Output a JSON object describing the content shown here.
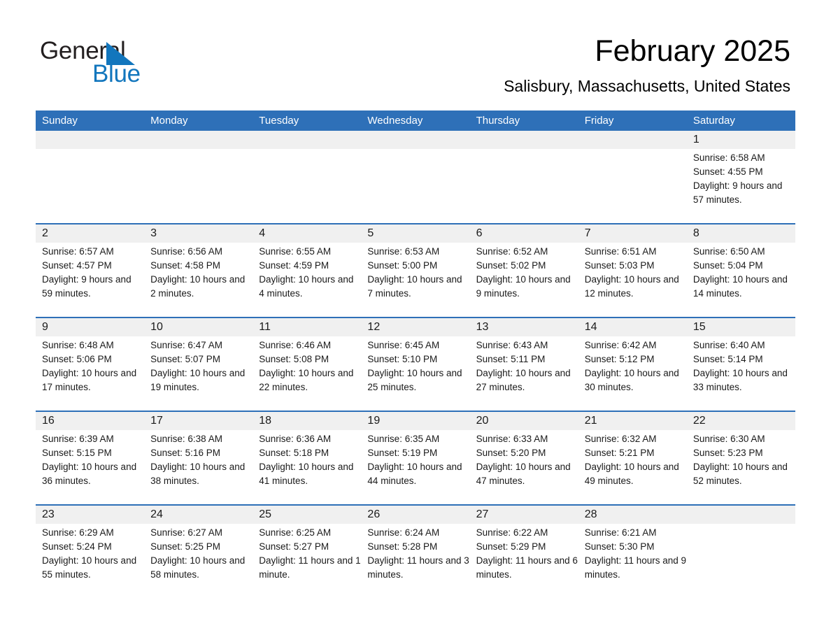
{
  "logo": {
    "word_one": "General",
    "word_two": "Blue",
    "triangle_color": "#1276bd",
    "text_color": "#231f20"
  },
  "header": {
    "title": "February 2025",
    "subtitle": "Salisbury, Massachusetts, United States"
  },
  "theme": {
    "header_blue": "#2e70b8",
    "row_divider_blue": "#2e70b8",
    "date_band_gray": "#f0f0f0",
    "cell_background": "#ffffff"
  },
  "calendar": {
    "weekdays": [
      "Sunday",
      "Monday",
      "Tuesday",
      "Wednesday",
      "Thursday",
      "Friday",
      "Saturday"
    ],
    "weeks": [
      [
        {
          "day": "",
          "sunrise": "",
          "sunset": "",
          "daylight": ""
        },
        {
          "day": "",
          "sunrise": "",
          "sunset": "",
          "daylight": ""
        },
        {
          "day": "",
          "sunrise": "",
          "sunset": "",
          "daylight": ""
        },
        {
          "day": "",
          "sunrise": "",
          "sunset": "",
          "daylight": ""
        },
        {
          "day": "",
          "sunrise": "",
          "sunset": "",
          "daylight": ""
        },
        {
          "day": "",
          "sunrise": "",
          "sunset": "",
          "daylight": ""
        },
        {
          "day": "1",
          "sunrise": "Sunrise: 6:58 AM",
          "sunset": "Sunset: 4:55 PM",
          "daylight": "Daylight: 9 hours and 57 minutes."
        }
      ],
      [
        {
          "day": "2",
          "sunrise": "Sunrise: 6:57 AM",
          "sunset": "Sunset: 4:57 PM",
          "daylight": "Daylight: 9 hours and 59 minutes."
        },
        {
          "day": "3",
          "sunrise": "Sunrise: 6:56 AM",
          "sunset": "Sunset: 4:58 PM",
          "daylight": "Daylight: 10 hours and 2 minutes."
        },
        {
          "day": "4",
          "sunrise": "Sunrise: 6:55 AM",
          "sunset": "Sunset: 4:59 PM",
          "daylight": "Daylight: 10 hours and 4 minutes."
        },
        {
          "day": "5",
          "sunrise": "Sunrise: 6:53 AM",
          "sunset": "Sunset: 5:00 PM",
          "daylight": "Daylight: 10 hours and 7 minutes."
        },
        {
          "day": "6",
          "sunrise": "Sunrise: 6:52 AM",
          "sunset": "Sunset: 5:02 PM",
          "daylight": "Daylight: 10 hours and 9 minutes."
        },
        {
          "day": "7",
          "sunrise": "Sunrise: 6:51 AM",
          "sunset": "Sunset: 5:03 PM",
          "daylight": "Daylight: 10 hours and 12 minutes."
        },
        {
          "day": "8",
          "sunrise": "Sunrise: 6:50 AM",
          "sunset": "Sunset: 5:04 PM",
          "daylight": "Daylight: 10 hours and 14 minutes."
        }
      ],
      [
        {
          "day": "9",
          "sunrise": "Sunrise: 6:48 AM",
          "sunset": "Sunset: 5:06 PM",
          "daylight": "Daylight: 10 hours and 17 minutes."
        },
        {
          "day": "10",
          "sunrise": "Sunrise: 6:47 AM",
          "sunset": "Sunset: 5:07 PM",
          "daylight": "Daylight: 10 hours and 19 minutes."
        },
        {
          "day": "11",
          "sunrise": "Sunrise: 6:46 AM",
          "sunset": "Sunset: 5:08 PM",
          "daylight": "Daylight: 10 hours and 22 minutes."
        },
        {
          "day": "12",
          "sunrise": "Sunrise: 6:45 AM",
          "sunset": "Sunset: 5:10 PM",
          "daylight": "Daylight: 10 hours and 25 minutes."
        },
        {
          "day": "13",
          "sunrise": "Sunrise: 6:43 AM",
          "sunset": "Sunset: 5:11 PM",
          "daylight": "Daylight: 10 hours and 27 minutes."
        },
        {
          "day": "14",
          "sunrise": "Sunrise: 6:42 AM",
          "sunset": "Sunset: 5:12 PM",
          "daylight": "Daylight: 10 hours and 30 minutes."
        },
        {
          "day": "15",
          "sunrise": "Sunrise: 6:40 AM",
          "sunset": "Sunset: 5:14 PM",
          "daylight": "Daylight: 10 hours and 33 minutes."
        }
      ],
      [
        {
          "day": "16",
          "sunrise": "Sunrise: 6:39 AM",
          "sunset": "Sunset: 5:15 PM",
          "daylight": "Daylight: 10 hours and 36 minutes."
        },
        {
          "day": "17",
          "sunrise": "Sunrise: 6:38 AM",
          "sunset": "Sunset: 5:16 PM",
          "daylight": "Daylight: 10 hours and 38 minutes."
        },
        {
          "day": "18",
          "sunrise": "Sunrise: 6:36 AM",
          "sunset": "Sunset: 5:18 PM",
          "daylight": "Daylight: 10 hours and 41 minutes."
        },
        {
          "day": "19",
          "sunrise": "Sunrise: 6:35 AM",
          "sunset": "Sunset: 5:19 PM",
          "daylight": "Daylight: 10 hours and 44 minutes."
        },
        {
          "day": "20",
          "sunrise": "Sunrise: 6:33 AM",
          "sunset": "Sunset: 5:20 PM",
          "daylight": "Daylight: 10 hours and 47 minutes."
        },
        {
          "day": "21",
          "sunrise": "Sunrise: 6:32 AM",
          "sunset": "Sunset: 5:21 PM",
          "daylight": "Daylight: 10 hours and 49 minutes."
        },
        {
          "day": "22",
          "sunrise": "Sunrise: 6:30 AM",
          "sunset": "Sunset: 5:23 PM",
          "daylight": "Daylight: 10 hours and 52 minutes."
        }
      ],
      [
        {
          "day": "23",
          "sunrise": "Sunrise: 6:29 AM",
          "sunset": "Sunset: 5:24 PM",
          "daylight": "Daylight: 10 hours and 55 minutes."
        },
        {
          "day": "24",
          "sunrise": "Sunrise: 6:27 AM",
          "sunset": "Sunset: 5:25 PM",
          "daylight": "Daylight: 10 hours and 58 minutes."
        },
        {
          "day": "25",
          "sunrise": "Sunrise: 6:25 AM",
          "sunset": "Sunset: 5:27 PM",
          "daylight": "Daylight: 11 hours and 1 minute."
        },
        {
          "day": "26",
          "sunrise": "Sunrise: 6:24 AM",
          "sunset": "Sunset: 5:28 PM",
          "daylight": "Daylight: 11 hours and 3 minutes."
        },
        {
          "day": "27",
          "sunrise": "Sunrise: 6:22 AM",
          "sunset": "Sunset: 5:29 PM",
          "daylight": "Daylight: 11 hours and 6 minutes."
        },
        {
          "day": "28",
          "sunrise": "Sunrise: 6:21 AM",
          "sunset": "Sunset: 5:30 PM",
          "daylight": "Daylight: 11 hours and 9 minutes."
        },
        {
          "day": "",
          "sunrise": "",
          "sunset": "",
          "daylight": ""
        }
      ]
    ]
  }
}
